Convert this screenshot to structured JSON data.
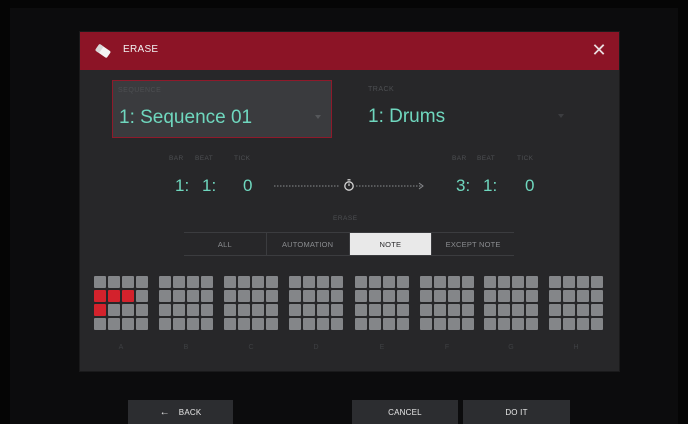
{
  "dialog": {
    "title": "ERASE",
    "icon": "eraser-icon",
    "close_icon": "close-icon",
    "colors": {
      "title_bar": "#8c1426",
      "accent_text": "#6fd7be",
      "active_pad": "#d3222c"
    }
  },
  "sequence": {
    "label": "SEQUENCE",
    "value": "1: Sequence 01"
  },
  "track": {
    "label": "TRACK",
    "value": "1: Drums"
  },
  "range": {
    "start": {
      "labels": [
        "BAR",
        "BEAT",
        "TICK"
      ],
      "bar": "1:",
      "beat": "1:",
      "tick": "0"
    },
    "end": {
      "labels": [
        "BAR",
        "BEAT",
        "TICK"
      ],
      "bar": "3:",
      "beat": "1:",
      "tick": "0"
    },
    "middle_icon": "stopwatch-icon"
  },
  "erase_mode": {
    "label": "ERASE",
    "options": [
      "ALL",
      "AUTOMATION",
      "NOTE",
      "EXCEPT NOTE"
    ],
    "selected": "NOTE"
  },
  "pad_banks": [
    {
      "label": "A",
      "active_pads": [
        4,
        5,
        6,
        8
      ]
    },
    {
      "label": "B",
      "active_pads": []
    },
    {
      "label": "C",
      "active_pads": []
    },
    {
      "label": "D",
      "active_pads": []
    },
    {
      "label": "E",
      "active_pads": []
    },
    {
      "label": "F",
      "active_pads": []
    },
    {
      "label": "G",
      "active_pads": []
    },
    {
      "label": "H",
      "active_pads": []
    }
  ],
  "footer": {
    "back": "BACK",
    "back_icon": "arrow-left-icon",
    "cancel": "CANCEL",
    "do_it": "DO IT"
  }
}
